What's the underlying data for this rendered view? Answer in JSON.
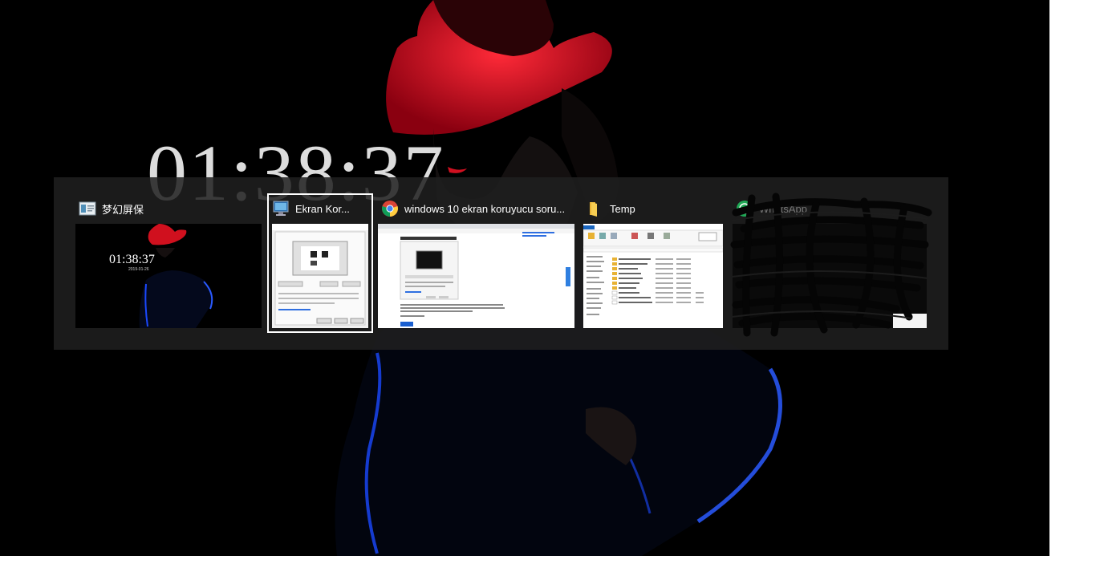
{
  "wallpaper": {
    "clock_text": "01:38:37"
  },
  "switcher": {
    "windows": [
      {
        "title": "梦幻屏保",
        "icon": "screensaver-app-icon",
        "selected": false,
        "thumbnail": {
          "clock": "01:38:37",
          "date": "2019-01-26"
        }
      },
      {
        "title": "Ekran Kor...",
        "icon": "screensaver-settings-icon",
        "selected": true
      },
      {
        "title": "windows 10 ekran koruyucu soru...",
        "icon": "chrome-icon",
        "selected": false
      },
      {
        "title": "Temp",
        "icon": "folder-icon",
        "selected": false
      },
      {
        "title": "WhatsApp",
        "icon": "whatsapp-icon",
        "selected": false,
        "redacted": true
      }
    ]
  },
  "colors": {
    "switcher_bg": "#202020",
    "hat_red": "#d0101e",
    "coat_blue": "#1638c8",
    "selection_border": "#ffffff"
  }
}
